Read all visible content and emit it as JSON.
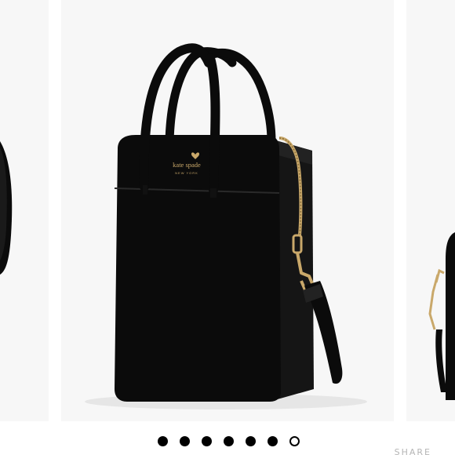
{
  "carousel": {
    "main_image": {
      "brand": "kate spade",
      "brand_sub": "NEW YORK"
    },
    "dots": [
      {
        "state": "filled"
      },
      {
        "state": "filled"
      },
      {
        "state": "filled"
      },
      {
        "state": "filled"
      },
      {
        "state": "filled"
      },
      {
        "state": "filled"
      },
      {
        "state": "active"
      }
    ],
    "share_label": "SHARE"
  },
  "colors": {
    "bag_black": "#0b0b0b",
    "hardware_gold": "#c9a86a",
    "slide_bg": "#f7f7f7"
  },
  "icons": {
    "carousel_indicator": "dot-icon"
  }
}
